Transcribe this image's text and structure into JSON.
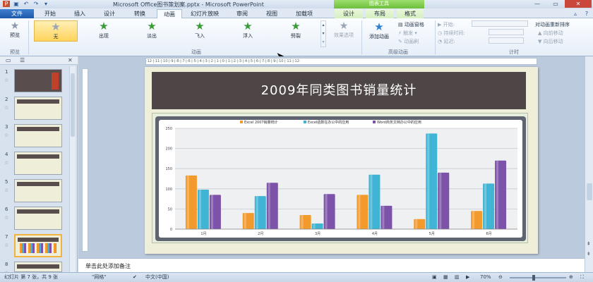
{
  "window": {
    "title": "Microsoft Office图书策划案.pptx - Microsoft PowerPoint",
    "tools_tab": "图表工具",
    "controls": [
      "—",
      "▭",
      "✕"
    ]
  },
  "tabs": [
    "文件",
    "开始",
    "插入",
    "设计",
    "转换",
    "动画",
    "幻灯片放映",
    "审阅",
    "视图",
    "加载项",
    "设计",
    "布局",
    "格式"
  ],
  "ribbon": {
    "preview": "预览",
    "effects": [
      "无",
      "出现",
      "淡出",
      "飞入",
      "浮入",
      "劈裂"
    ],
    "effect_options": "效果选项",
    "add_animation": "添加动画",
    "animation_pane": "动画窗格",
    "trigger": "触发",
    "animation_painter": "动画刷",
    "start": "开始:",
    "duration": "持续时间:",
    "delay": "延迟:",
    "reorder": "对动画重新排序",
    "move_earlier": "向前移动",
    "move_later": "向后移动",
    "groups": [
      "预览",
      "动画",
      "高级动画",
      "计时"
    ]
  },
  "thumbnails": {
    "numbers": [
      "1",
      "2",
      "3",
      "4",
      "5",
      "6",
      "7",
      "8"
    ]
  },
  "slide": {
    "title": "2009年同类图书销量统计"
  },
  "chart_data": {
    "type": "bar",
    "categories": [
      "1月",
      "2月",
      "3月",
      "4月",
      "5月",
      "6月"
    ],
    "series": [
      {
        "name": "Excel 2007销量统计",
        "values": [
          133,
          40,
          35,
          85,
          25,
          45
        ]
      },
      {
        "name": "Excel函数在办公中的应用",
        "values": [
          98,
          82,
          14,
          135,
          237,
          113
        ]
      },
      {
        "name": "Word商务文档办公中的应用",
        "values": [
          85,
          115,
          87,
          58,
          140,
          170
        ]
      }
    ],
    "yticks": [
      "0",
      "50",
      "100",
      "150",
      "200",
      "250"
    ],
    "ylim": [
      0,
      250
    ],
    "colors": [
      "#f39a2c",
      "#3fb4d4",
      "#7c53a8"
    ],
    "grid": true,
    "legend": "top"
  },
  "notes": {
    "placeholder": "单击此处添加备注"
  },
  "status": {
    "slide_info": "幻灯片 第 7 张，共 9 张",
    "theme": "\"网格\"",
    "language": "中文(中国)",
    "zoom": "70%"
  }
}
